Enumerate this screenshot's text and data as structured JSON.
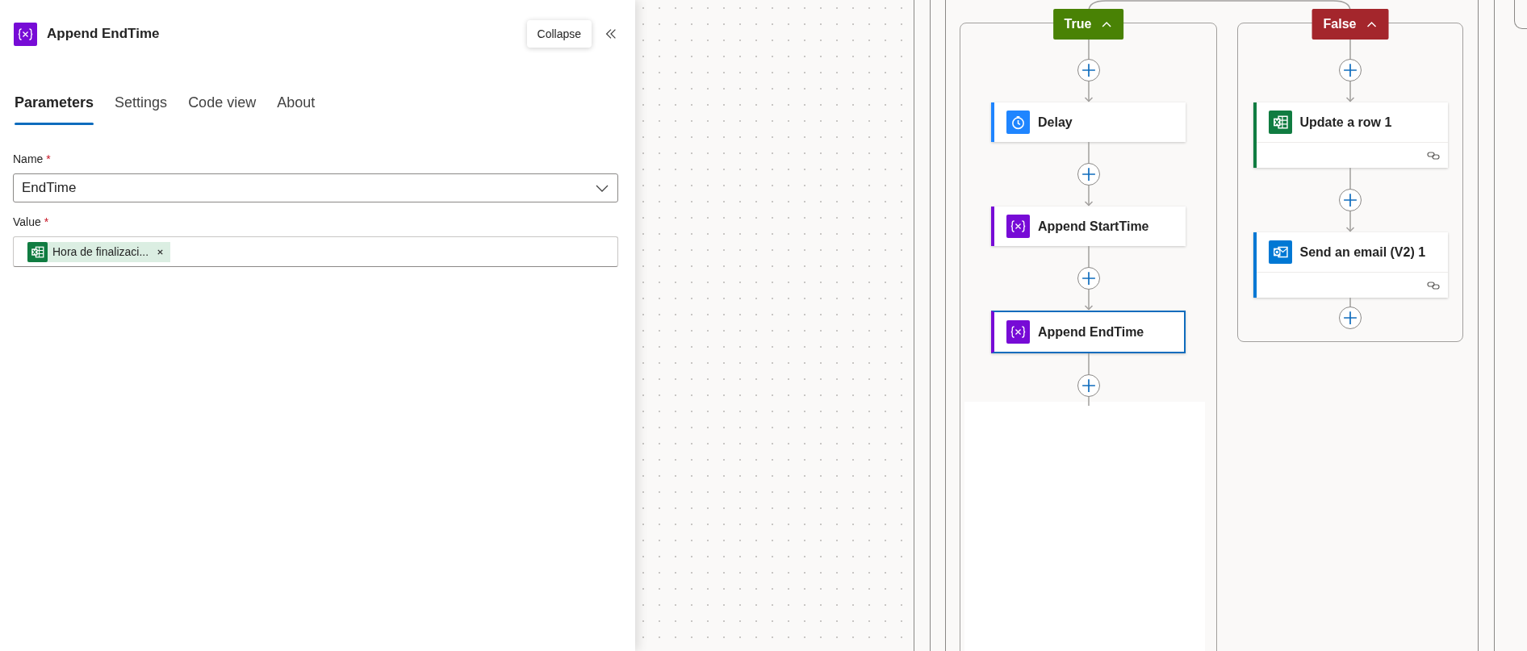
{
  "panel": {
    "title": "Append EndTime",
    "collapse_tooltip": "Collapse",
    "tabs": [
      {
        "label": "Parameters",
        "selected": true
      },
      {
        "label": "Settings",
        "selected": false
      },
      {
        "label": "Code view",
        "selected": false
      },
      {
        "label": "About",
        "selected": false
      }
    ],
    "fields": [
      {
        "kind": "dropdown",
        "label": "Name",
        "required_mark": "*",
        "value": "EndTime"
      },
      {
        "kind": "tokens",
        "label": "Value",
        "required_mark": "*",
        "tokens": [
          {
            "kind": "excel",
            "label": "Hora de finalizaci..."
          }
        ]
      }
    ]
  },
  "canvas": {
    "branches": [
      {
        "label": "True",
        "color": "#498205",
        "expanded": true,
        "actions": [
          {
            "kind": "delay",
            "title": "Delay",
            "footer_link": false,
            "selected": false
          },
          {
            "kind": "variable",
            "title": "Append StartTime",
            "footer_link": false,
            "selected": false
          },
          {
            "kind": "variable",
            "title": "Append EndTime",
            "footer_link": false,
            "selected": true
          }
        ]
      },
      {
        "label": "False",
        "color": "#a4262c",
        "expanded": true,
        "actions": [
          {
            "kind": "excel",
            "title": "Update a row 1",
            "footer_link": true,
            "selected": false
          },
          {
            "kind": "outlook",
            "title": "Send an email (V2) 1",
            "footer_link": true,
            "selected": false
          }
        ]
      }
    ]
  }
}
